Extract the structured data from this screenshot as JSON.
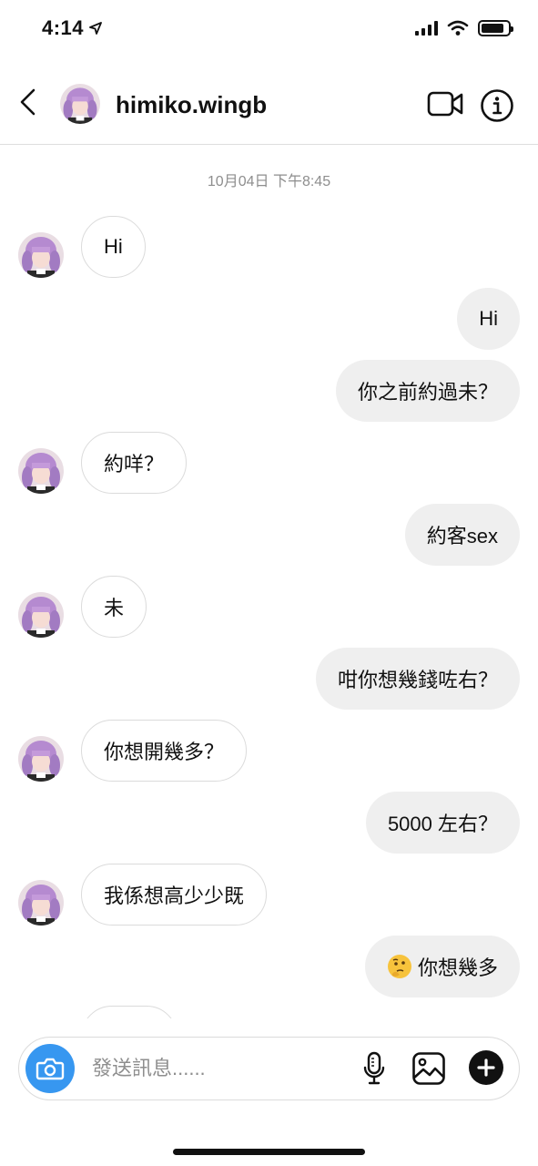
{
  "status_bar": {
    "time": "4:14",
    "location_icon": "location-arrow-icon",
    "signal_icon": "cellular-signal-icon",
    "wifi_icon": "wifi-icon",
    "battery_icon": "battery-icon",
    "battery_level": 0.85
  },
  "header": {
    "back_icon": "chevron-left-icon",
    "username": "himiko.wingb",
    "video_icon": "video-camera-icon",
    "info_icon": "info-icon"
  },
  "thread": {
    "timestamp": "10月04日 下午8:45",
    "messages": [
      {
        "from": "them",
        "text": "Hi"
      },
      {
        "from": "me",
        "text": "Hi"
      },
      {
        "from": "me",
        "text": "你之前約過未？"
      },
      {
        "from": "them",
        "text": "約咩？"
      },
      {
        "from": "me",
        "text": "約客sex"
      },
      {
        "from": "them",
        "text": "未"
      },
      {
        "from": "me",
        "text": "咁你想幾錢咗右？"
      },
      {
        "from": "them",
        "text": "你想開幾多？"
      },
      {
        "from": "me",
        "text": "5000 左右？"
      },
      {
        "from": "them",
        "text": "我係想高少少既"
      },
      {
        "from": "me",
        "text": "你想幾多",
        "emoji": "thinking-face"
      }
    ]
  },
  "composer": {
    "camera_icon": "camera-icon",
    "placeholder": "發送訊息......",
    "value": "",
    "mic_icon": "microphone-icon",
    "gallery_icon": "image-gallery-icon",
    "plus_icon": "plus-icon"
  },
  "colors": {
    "accent": "#3797f0",
    "outgoing_bubble": "#efefef",
    "incoming_border": "#dbdbdb",
    "muted_text": "#8e8e8e"
  }
}
